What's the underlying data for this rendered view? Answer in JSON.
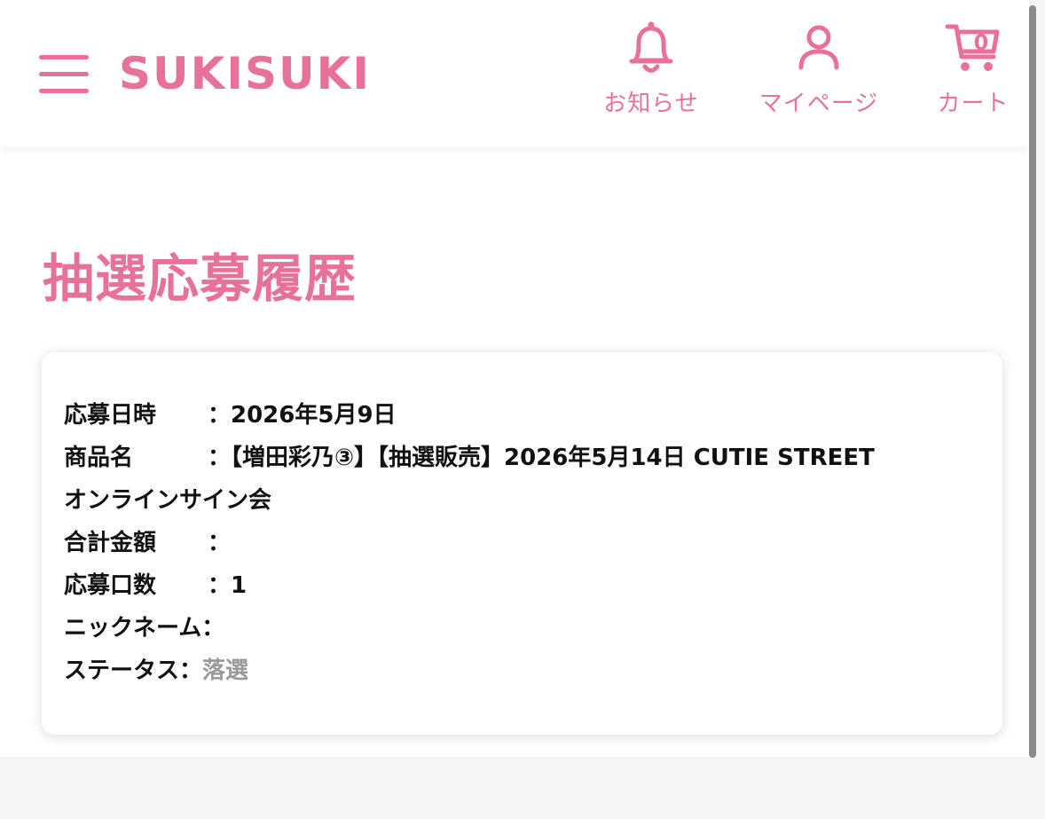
{
  "header": {
    "logo": "SUKISUKI",
    "nav": [
      {
        "label": "お知らせ",
        "icon": "bell-icon"
      },
      {
        "label": "マイページ",
        "icon": "user-icon"
      },
      {
        "label": "カート",
        "icon": "cart-icon",
        "count": "0"
      }
    ]
  },
  "page": {
    "title": "抽選応募履歴"
  },
  "entry": {
    "date_label": "応募日時",
    "date_value": "：2026年5月9日",
    "product_label": "商品名",
    "product_value": "：【増田彩乃③】【抽選販売】2026年5月14日 CUTIE STREET",
    "product_value_cont": "オンラインサイン会",
    "total_label": "合計金額",
    "total_value": "：",
    "count_label": "応募口数",
    "count_value": "：1",
    "nickname_label": "ニックネーム：",
    "status_label": "ステータス：",
    "status_value": "落選"
  },
  "colors": {
    "accent": "#e8719a",
    "status_gray": "#9a9a9a"
  }
}
